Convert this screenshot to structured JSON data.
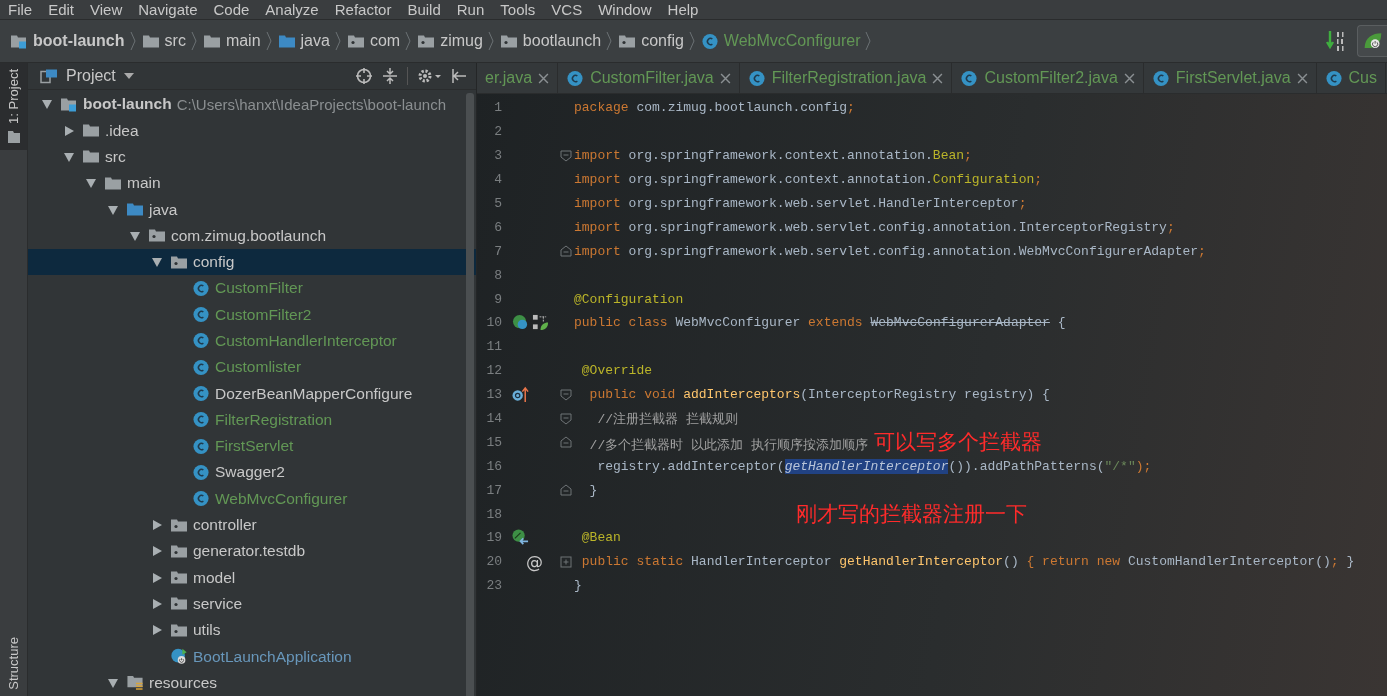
{
  "menu": [
    "File",
    "Edit",
    "View",
    "Navigate",
    "Code",
    "Analyze",
    "Refactor",
    "Build",
    "Run",
    "Tools",
    "VCS",
    "Window",
    "Help"
  ],
  "breadcrumbs": [
    {
      "label": "boot-launch",
      "kind": "module"
    },
    {
      "label": "src",
      "kind": "folder"
    },
    {
      "label": "main",
      "kind": "folder"
    },
    {
      "label": "java",
      "kind": "source"
    },
    {
      "label": "com",
      "kind": "package"
    },
    {
      "label": "zimug",
      "kind": "package"
    },
    {
      "label": "bootlaunch",
      "kind": "package"
    },
    {
      "label": "config",
      "kind": "package"
    },
    {
      "label": "WebMvcConfigurer",
      "kind": "class"
    }
  ],
  "side_stripe": {
    "top": "1: Project",
    "bottom": "Structure"
  },
  "project_panel": {
    "title": "Project",
    "tree": [
      {
        "label": "boot-launch",
        "path": "C:\\Users\\hanxt\\IdeaProjects\\boot-launch",
        "kind": "module",
        "expanded": true,
        "selected": false,
        "children": [
          {
            "label": ".idea",
            "kind": "folder",
            "expanded": false,
            "selected": false
          },
          {
            "label": "src",
            "kind": "folder",
            "expanded": true,
            "selected": false,
            "children": [
              {
                "label": "main",
                "kind": "folder",
                "expanded": true,
                "selected": false,
                "children": [
                  {
                    "label": "java",
                    "kind": "source",
                    "expanded": true,
                    "selected": false,
                    "children": [
                      {
                        "label": "com.zimug.bootlaunch",
                        "kind": "package",
                        "expanded": true,
                        "selected": false,
                        "children": [
                          {
                            "label": "config",
                            "kind": "package",
                            "expanded": true,
                            "selected": true,
                            "children": [
                              {
                                "label": "CustomFilter",
                                "kind": "class",
                                "color": "#629755",
                                "selected": false
                              },
                              {
                                "label": "CustomFilter2",
                                "kind": "class",
                                "color": "#629755",
                                "selected": false
                              },
                              {
                                "label": "CustomHandlerInterceptor",
                                "kind": "class",
                                "color": "#629755",
                                "selected": false
                              },
                              {
                                "label": "Customlister",
                                "kind": "class",
                                "color": "#629755",
                                "selected": false
                              },
                              {
                                "label": "DozerBeanMapperConfigure",
                                "kind": "class",
                                "color": "#c8c8c8",
                                "selected": false
                              },
                              {
                                "label": "FilterRegistration",
                                "kind": "class",
                                "color": "#629755",
                                "selected": false
                              },
                              {
                                "label": "FirstServlet",
                                "kind": "class",
                                "color": "#629755",
                                "selected": false
                              },
                              {
                                "label": "Swagger2",
                                "kind": "class",
                                "color": "#c8c8c8",
                                "selected": false
                              },
                              {
                                "label": "WebMvcConfigurer",
                                "kind": "class",
                                "color": "#629755",
                                "selected": false
                              }
                            ]
                          },
                          {
                            "label": "controller",
                            "kind": "package",
                            "expanded": false,
                            "selected": false
                          },
                          {
                            "label": "generator.testdb",
                            "kind": "package",
                            "expanded": false,
                            "selected": false
                          },
                          {
                            "label": "model",
                            "kind": "package",
                            "expanded": false,
                            "selected": false
                          },
                          {
                            "label": "service",
                            "kind": "package",
                            "expanded": false,
                            "selected": false
                          },
                          {
                            "label": "utils",
                            "kind": "package",
                            "expanded": false,
                            "selected": false
                          },
                          {
                            "label": "BootLaunchApplication",
                            "kind": "boot",
                            "color": "#6897bb",
                            "selected": false
                          }
                        ]
                      }
                    ]
                  },
                  {
                    "label": "resources",
                    "kind": "resources",
                    "expanded": true,
                    "selected": false
                  }
                ]
              }
            ]
          }
        ]
      }
    ]
  },
  "tabs": [
    {
      "label": "er.java",
      "kind": "cut",
      "selected": false
    },
    {
      "label": "CustomFilter.java",
      "kind": "class",
      "selected": false
    },
    {
      "label": "FilterRegistration.java",
      "kind": "class",
      "selected": false
    },
    {
      "label": "CustomFilter2.java",
      "kind": "class",
      "selected": false
    },
    {
      "label": "FirstServlet.java",
      "kind": "class",
      "selected": false
    },
    {
      "label": "Cus",
      "kind": "class",
      "selected": false
    }
  ],
  "code_lines": [
    {
      "number": "1",
      "tokens": [
        {
          "text": "package ",
          "kind": "kw"
        },
        {
          "text": "com.zimug.bootlaunch.config",
          "kind": "plain"
        },
        {
          "text": ";",
          "kind": "punct"
        }
      ]
    },
    {
      "number": "2"
    },
    {
      "number": "3",
      "gutter_marks": [
        {
          "kind": "fold-start"
        }
      ],
      "tokens": [
        {
          "text": "import ",
          "kind": "kw"
        },
        {
          "text": "org.springframework.context.annotation.",
          "kind": "plain"
        },
        {
          "text": "Bean",
          "kind": "annot"
        },
        {
          "text": ";",
          "kind": "punct"
        }
      ]
    },
    {
      "number": "4",
      "tokens": [
        {
          "text": "import ",
          "kind": "kw"
        },
        {
          "text": "org.springframework.context.annotation.",
          "kind": "plain"
        },
        {
          "text": "Configuration",
          "kind": "annot"
        },
        {
          "text": ";",
          "kind": "punct"
        }
      ]
    },
    {
      "number": "5",
      "tokens": [
        {
          "text": "import ",
          "kind": "kw"
        },
        {
          "text": "org.springframework.web.servlet.HandlerInterceptor",
          "kind": "plain"
        },
        {
          "text": ";",
          "kind": "punct"
        }
      ]
    },
    {
      "number": "6",
      "tokens": [
        {
          "text": "import ",
          "kind": "kw"
        },
        {
          "text": "org.springframework.web.servlet.config.annotation.InterceptorRegistry",
          "kind": "plain"
        },
        {
          "text": ";",
          "kind": "punct"
        }
      ]
    },
    {
      "number": "7",
      "gutter_marks": [
        {
          "kind": "fold-end"
        }
      ],
      "tokens": [
        {
          "text": "import ",
          "kind": "kw"
        },
        {
          "text": "org.springframework.web.servlet.config.annotation.WebMvcConfigurerAdapter",
          "kind": "plain"
        },
        {
          "text": ";",
          "kind": "punct"
        }
      ]
    },
    {
      "number": "8"
    },
    {
      "number": "9",
      "tokens": [
        {
          "text": "@Configuration",
          "kind": "annot"
        }
      ]
    },
    {
      "number": "10",
      "gutter_marks": [
        {
          "kind": "bean-class"
        }
      ],
      "tokens": [
        {
          "text": "public class ",
          "kind": "kw"
        },
        {
          "text": "WebMvcConfigurer ",
          "kind": "plain"
        },
        {
          "text": "extends ",
          "kind": "kw"
        },
        {
          "text": "WebMvcConfigurerAdapter",
          "kind": "strike"
        },
        {
          "text": " {",
          "kind": "plain"
        }
      ]
    },
    {
      "number": "11"
    },
    {
      "number": "12",
      "tokens": [
        {
          "text": " @Override",
          "kind": "annot"
        }
      ]
    },
    {
      "number": "13",
      "gutter_marks": [
        {
          "kind": "override"
        },
        {
          "kind": "fold-start"
        }
      ],
      "tokens": [
        {
          "text": "  public void ",
          "kind": "kw"
        },
        {
          "text": "addInterceptors",
          "kind": "method"
        },
        {
          "text": "(InterceptorRegistry registry) {",
          "kind": "plain"
        }
      ]
    },
    {
      "number": "14",
      "gutter_marks": [
        {
          "kind": "fold-start"
        }
      ],
      "tokens": [
        {
          "text": "   //注册拦截器 拦截规则",
          "kind": "comment"
        }
      ]
    },
    {
      "number": "15",
      "gutter_marks": [
        {
          "kind": "fold-end"
        }
      ],
      "tokens": [
        {
          "text": "  //多个拦截器时 以此添加 执行顺序按添加顺序",
          "kind": "comment"
        },
        {
          "text": "可以写多个拦截器",
          "kind": "note"
        }
      ]
    },
    {
      "number": "16",
      "tokens": [
        {
          "text": "   registry.addInterceptor(",
          "kind": "plain"
        },
        {
          "text": "getHandlerInterceptor",
          "kind": "selected"
        },
        {
          "text": "()).addPathPatterns(",
          "kind": "plain"
        },
        {
          "text": "\"/*\"",
          "kind": "string"
        },
        {
          "text": ");",
          "kind": "punct"
        }
      ]
    },
    {
      "number": "17",
      "gutter_marks": [
        {
          "kind": "fold-end"
        }
      ],
      "tokens": [
        {
          "text": "  }",
          "kind": "plain"
        }
      ]
    },
    {
      "number": "18",
      "tokens": [
        {
          "text": "刚才写的拦截器注册一下",
          "kind": "note"
        }
      ]
    },
    {
      "number": "19",
      "gutter_marks": [
        {
          "kind": "bean"
        }
      ],
      "tokens": [
        {
          "text": " @Bean",
          "kind": "annot"
        }
      ]
    },
    {
      "number": "20",
      "gutter_text": "@",
      "gutter_marks": [
        {
          "kind": "fold-collapsed"
        }
      ],
      "tokens": [
        {
          "text": " public static ",
          "kind": "kw"
        },
        {
          "text": "HandlerInterceptor ",
          "kind": "plain"
        },
        {
          "text": "getHandlerInterceptor",
          "kind": "method"
        },
        {
          "text": "() ",
          "kind": "plain"
        },
        {
          "text": "{ ",
          "kind": "punct"
        },
        {
          "text": "return new ",
          "kind": "kw"
        },
        {
          "text": "CustomHandlerInterceptor()",
          "kind": "plain"
        },
        {
          "text": "; ",
          "kind": "punct"
        },
        {
          "text": "}",
          "kind": "plain"
        }
      ]
    },
    {
      "number": "23",
      "tokens": [
        {
          "text": "}",
          "kind": "plain"
        }
      ]
    }
  ]
}
